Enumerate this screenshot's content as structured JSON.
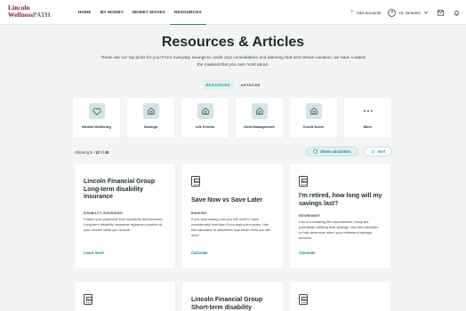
{
  "brand": {
    "line1": "Lincoln",
    "line2a": "Wellness",
    "line2b": "PATH"
  },
  "nav": {
    "links": [
      "HOME",
      "MY MONEY",
      "MONEY MOVES",
      "RESOURCES"
    ],
    "add_accounts": "Add accounts",
    "user_greeting": "Hi, Janeane"
  },
  "hero": {
    "title": "Resources & Articles",
    "subtitle": "These are our top picks for you! From everyday savings to credit card consolidation and planning that next dream vacation, we have curated the material that you care most about."
  },
  "tabs": [
    "RESOURCES",
    "ARTICLES"
  ],
  "categories": [
    {
      "label": "Mental Wellbeing",
      "icon": "heart-icon"
    },
    {
      "label": "Savings",
      "icon": "home-icon"
    },
    {
      "label": "Life Events",
      "icon": "home-icon"
    },
    {
      "label": "Debt Management",
      "icon": "home-icon"
    },
    {
      "label": "Credit Score",
      "icon": "home-icon"
    },
    {
      "label": "More",
      "icon": "more-dots-icon"
    }
  ],
  "results": {
    "showing_prefix": "Showing ",
    "range": "1 - 12",
    "of_text": " of ",
    "total": "45",
    "show_calculators": "Show calculators",
    "sort": "Sort"
  },
  "cards": [
    {
      "title": "Lincoln Financial Group Long-term disability insurance",
      "tag": "DISABILITY INSURANCE",
      "body": "Protect your paycheck from accidents and illnesses. Long-term disability insurance replaces a portion of your income while you recover.",
      "link": "Learn more"
    },
    {
      "title": "Save Now vs Save Later",
      "tag": "BANKING",
      "body": "If you start saving now you will need to save considerably less than if you wait a few years. Use this calculator to determine how much extra you will need",
      "link": "Calculate"
    },
    {
      "title": "I'm retired, how long will my savings last?",
      "tag": "RETIREMENT",
      "body": "Due to increasing life expectancies, many are potentially outliving their savings. Use this calculator to help determine when your retirement savings account.",
      "link": "Calculate"
    },
    {
      "title": "Lincoln Financial Group Short-term disability"
    }
  ],
  "colors": {
    "accent": "#1a8c8c",
    "brand": "#8a1538",
    "background": "#f3f4f4"
  }
}
